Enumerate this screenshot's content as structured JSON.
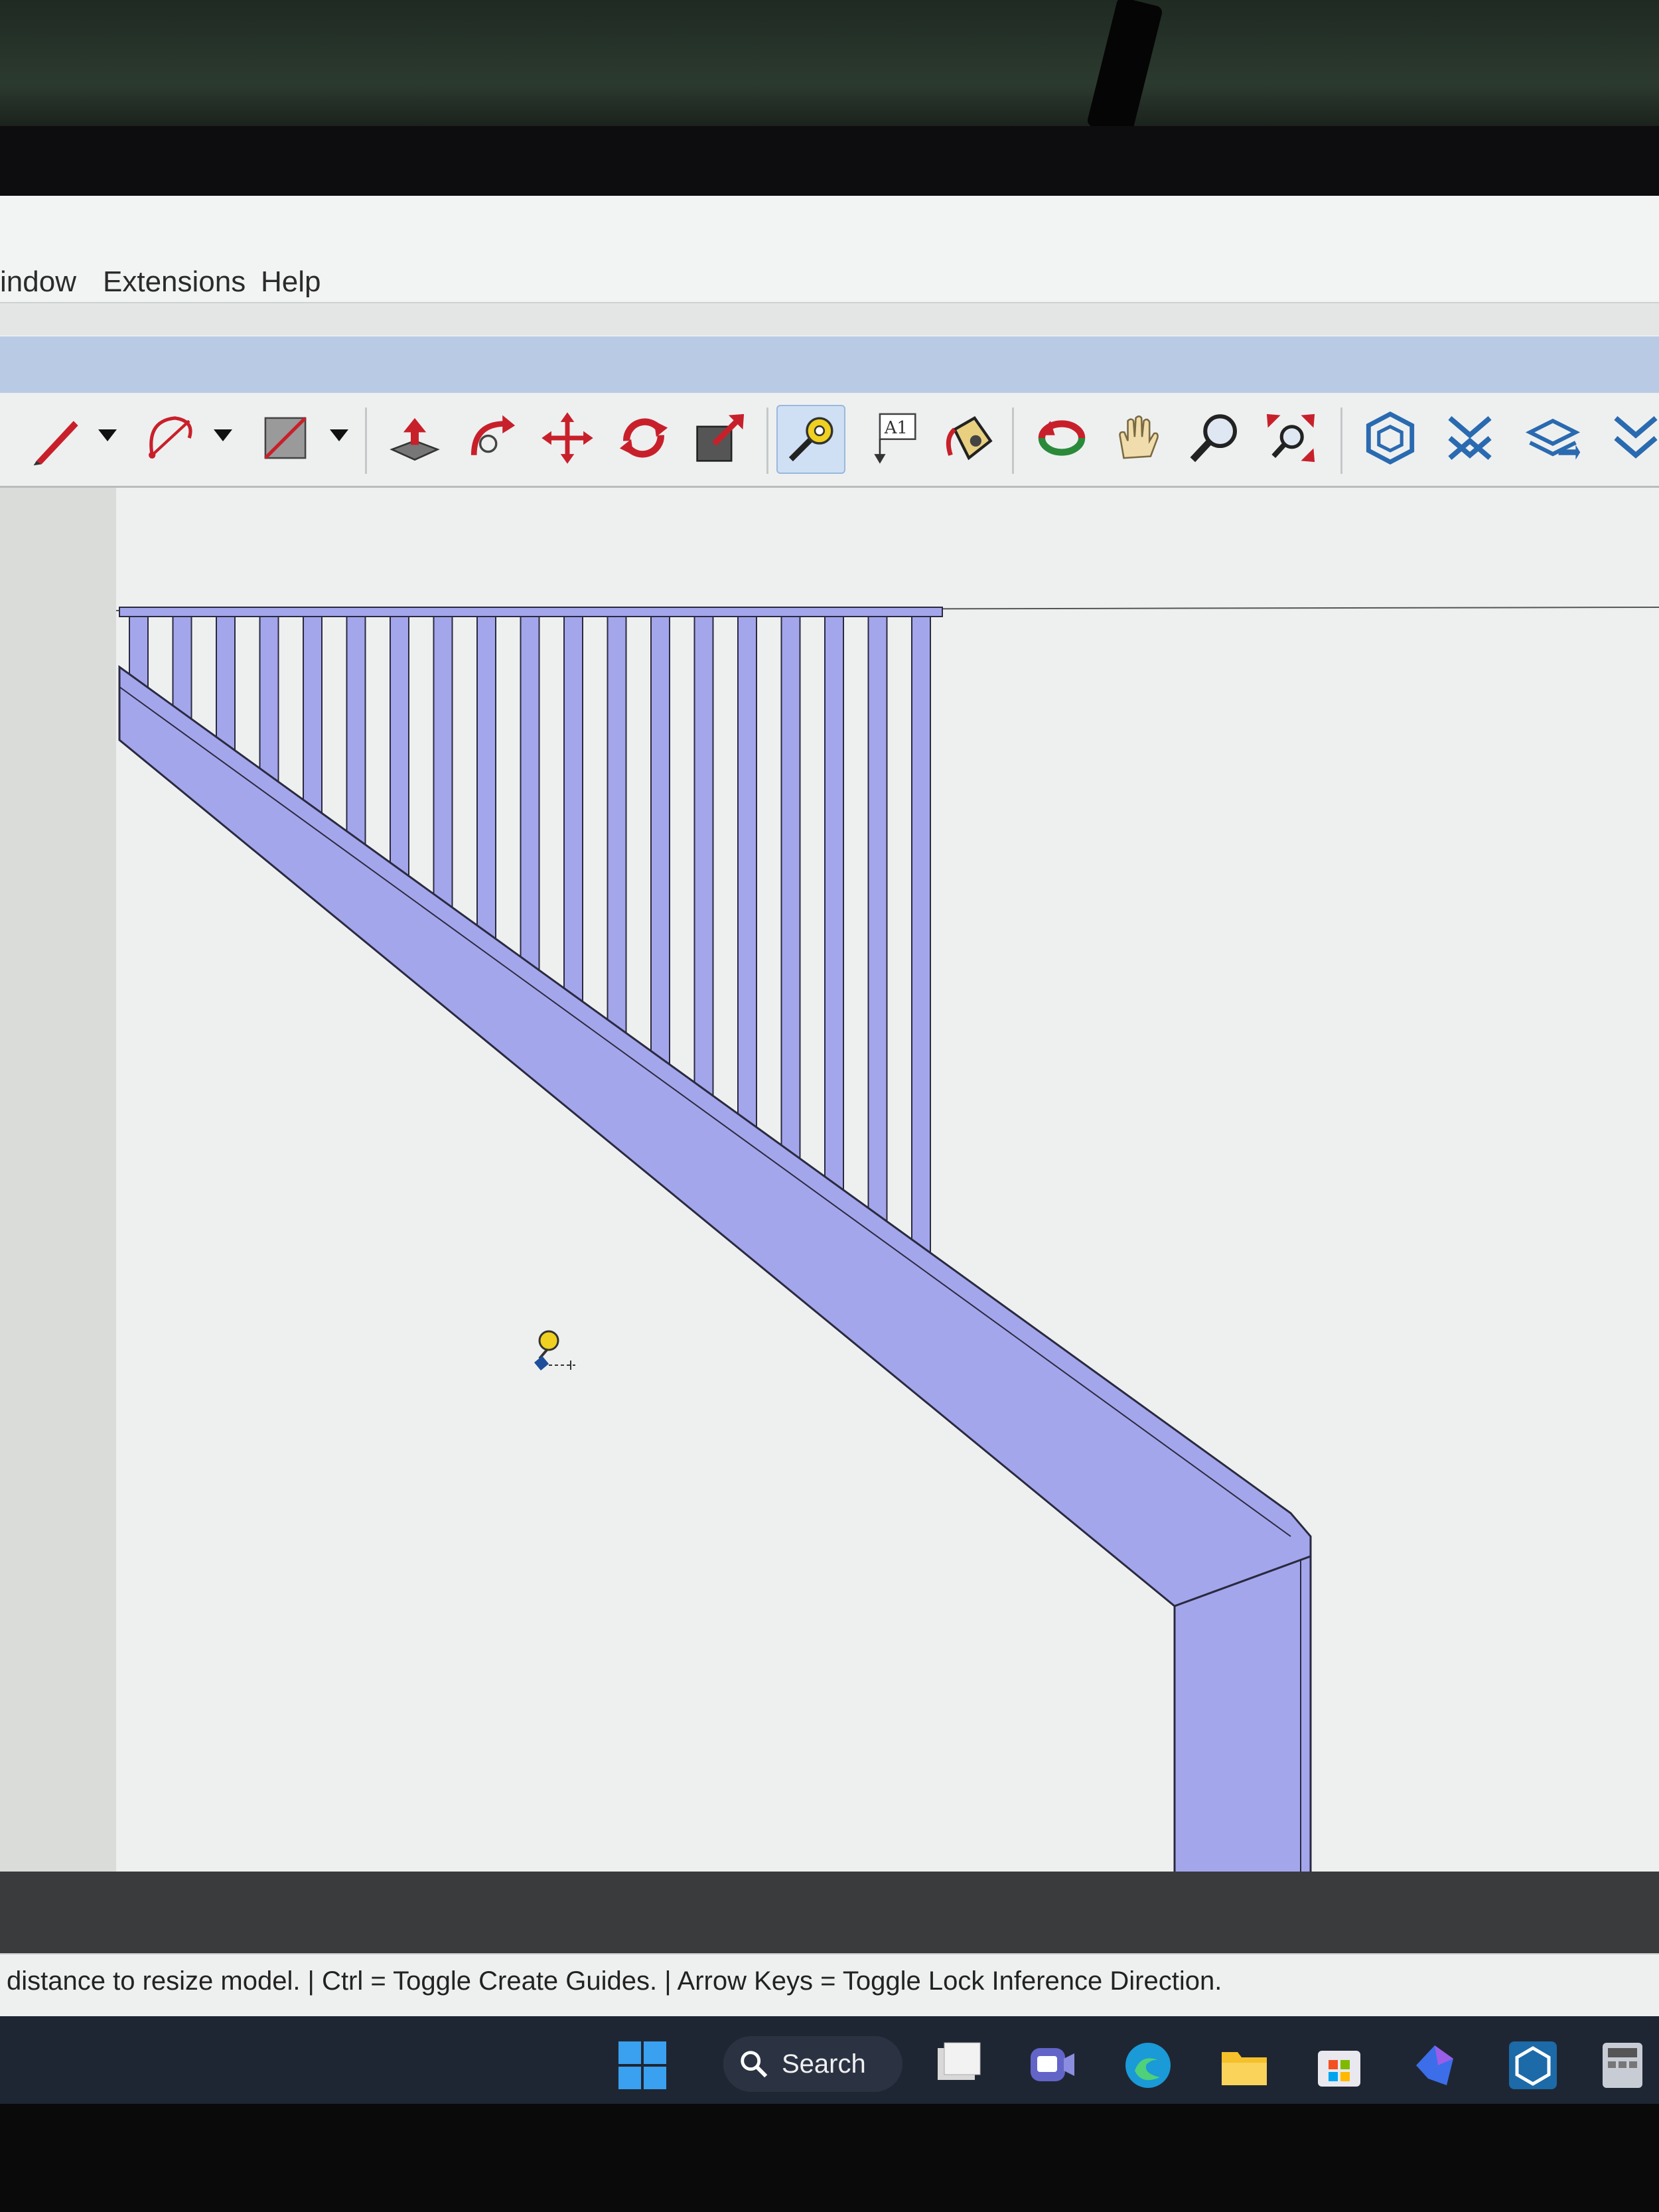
{
  "menu": {
    "items": [
      {
        "label": "indow"
      },
      {
        "label": "Extensions"
      },
      {
        "label": "Help"
      }
    ]
  },
  "toolbar": {
    "tools": [
      {
        "icon": "pencil-line-icon"
      },
      {
        "icon": "arc-icon"
      },
      {
        "icon": "rectangle-icon"
      },
      {
        "icon": "push-pull-icon"
      },
      {
        "icon": "follow-me-icon"
      },
      {
        "icon": "move-icon"
      },
      {
        "icon": "rotate-icon"
      },
      {
        "icon": "scale-icon"
      },
      {
        "icon": "tape-measure-icon",
        "active": true
      },
      {
        "icon": "text-label-icon",
        "text": "A1"
      },
      {
        "icon": "paint-bucket-icon"
      },
      {
        "icon": "orbit-icon"
      },
      {
        "icon": "pan-hand-icon"
      },
      {
        "icon": "zoom-icon"
      },
      {
        "icon": "zoom-extents-icon"
      },
      {
        "icon": "warehouse-icon"
      },
      {
        "icon": "extension-icon"
      },
      {
        "icon": "layers-icon"
      },
      {
        "icon": "more-tools-icon"
      }
    ]
  },
  "status": {
    "text": "distance to resize model. | Ctrl = Toggle Create Guides. | Arrow Keys = Toggle Lock Inference Direction."
  },
  "taskbar": {
    "search_label": "Search",
    "apps": [
      "windows-start-icon",
      "file-explorer-icon",
      "teams-icon",
      "edge-icon",
      "folder-icon",
      "store-icon",
      "copilot-icon",
      "sketchup-icon",
      "calculator-icon"
    ]
  },
  "model": {
    "fill_color": "#a4a6ec",
    "edge_color": "#2a2a40",
    "baluster_count": 19
  }
}
